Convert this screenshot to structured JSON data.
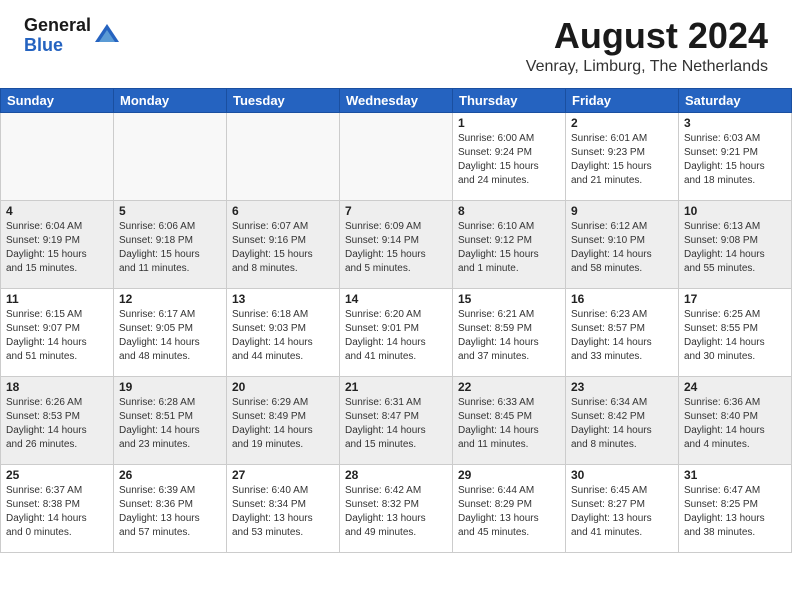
{
  "header": {
    "logo_general": "General",
    "logo_blue": "Blue",
    "month_title": "August 2024",
    "location": "Venray, Limburg, The Netherlands"
  },
  "days_of_week": [
    "Sunday",
    "Monday",
    "Tuesday",
    "Wednesday",
    "Thursday",
    "Friday",
    "Saturday"
  ],
  "weeks": [
    {
      "alt": false,
      "days": [
        {
          "num": "",
          "info": "",
          "empty": true
        },
        {
          "num": "",
          "info": "",
          "empty": true
        },
        {
          "num": "",
          "info": "",
          "empty": true
        },
        {
          "num": "",
          "info": "",
          "empty": true
        },
        {
          "num": "1",
          "info": "Sunrise: 6:00 AM\nSunset: 9:24 PM\nDaylight: 15 hours\nand 24 minutes.",
          "empty": false
        },
        {
          "num": "2",
          "info": "Sunrise: 6:01 AM\nSunset: 9:23 PM\nDaylight: 15 hours\nand 21 minutes.",
          "empty": false
        },
        {
          "num": "3",
          "info": "Sunrise: 6:03 AM\nSunset: 9:21 PM\nDaylight: 15 hours\nand 18 minutes.",
          "empty": false
        }
      ]
    },
    {
      "alt": true,
      "days": [
        {
          "num": "4",
          "info": "Sunrise: 6:04 AM\nSunset: 9:19 PM\nDaylight: 15 hours\nand 15 minutes.",
          "empty": false
        },
        {
          "num": "5",
          "info": "Sunrise: 6:06 AM\nSunset: 9:18 PM\nDaylight: 15 hours\nand 11 minutes.",
          "empty": false
        },
        {
          "num": "6",
          "info": "Sunrise: 6:07 AM\nSunset: 9:16 PM\nDaylight: 15 hours\nand 8 minutes.",
          "empty": false
        },
        {
          "num": "7",
          "info": "Sunrise: 6:09 AM\nSunset: 9:14 PM\nDaylight: 15 hours\nand 5 minutes.",
          "empty": false
        },
        {
          "num": "8",
          "info": "Sunrise: 6:10 AM\nSunset: 9:12 PM\nDaylight: 15 hours\nand 1 minute.",
          "empty": false
        },
        {
          "num": "9",
          "info": "Sunrise: 6:12 AM\nSunset: 9:10 PM\nDaylight: 14 hours\nand 58 minutes.",
          "empty": false
        },
        {
          "num": "10",
          "info": "Sunrise: 6:13 AM\nSunset: 9:08 PM\nDaylight: 14 hours\nand 55 minutes.",
          "empty": false
        }
      ]
    },
    {
      "alt": false,
      "days": [
        {
          "num": "11",
          "info": "Sunrise: 6:15 AM\nSunset: 9:07 PM\nDaylight: 14 hours\nand 51 minutes.",
          "empty": false
        },
        {
          "num": "12",
          "info": "Sunrise: 6:17 AM\nSunset: 9:05 PM\nDaylight: 14 hours\nand 48 minutes.",
          "empty": false
        },
        {
          "num": "13",
          "info": "Sunrise: 6:18 AM\nSunset: 9:03 PM\nDaylight: 14 hours\nand 44 minutes.",
          "empty": false
        },
        {
          "num": "14",
          "info": "Sunrise: 6:20 AM\nSunset: 9:01 PM\nDaylight: 14 hours\nand 41 minutes.",
          "empty": false
        },
        {
          "num": "15",
          "info": "Sunrise: 6:21 AM\nSunset: 8:59 PM\nDaylight: 14 hours\nand 37 minutes.",
          "empty": false
        },
        {
          "num": "16",
          "info": "Sunrise: 6:23 AM\nSunset: 8:57 PM\nDaylight: 14 hours\nand 33 minutes.",
          "empty": false
        },
        {
          "num": "17",
          "info": "Sunrise: 6:25 AM\nSunset: 8:55 PM\nDaylight: 14 hours\nand 30 minutes.",
          "empty": false
        }
      ]
    },
    {
      "alt": true,
      "days": [
        {
          "num": "18",
          "info": "Sunrise: 6:26 AM\nSunset: 8:53 PM\nDaylight: 14 hours\nand 26 minutes.",
          "empty": false
        },
        {
          "num": "19",
          "info": "Sunrise: 6:28 AM\nSunset: 8:51 PM\nDaylight: 14 hours\nand 23 minutes.",
          "empty": false
        },
        {
          "num": "20",
          "info": "Sunrise: 6:29 AM\nSunset: 8:49 PM\nDaylight: 14 hours\nand 19 minutes.",
          "empty": false
        },
        {
          "num": "21",
          "info": "Sunrise: 6:31 AM\nSunset: 8:47 PM\nDaylight: 14 hours\nand 15 minutes.",
          "empty": false
        },
        {
          "num": "22",
          "info": "Sunrise: 6:33 AM\nSunset: 8:45 PM\nDaylight: 14 hours\nand 11 minutes.",
          "empty": false
        },
        {
          "num": "23",
          "info": "Sunrise: 6:34 AM\nSunset: 8:42 PM\nDaylight: 14 hours\nand 8 minutes.",
          "empty": false
        },
        {
          "num": "24",
          "info": "Sunrise: 6:36 AM\nSunset: 8:40 PM\nDaylight: 14 hours\nand 4 minutes.",
          "empty": false
        }
      ]
    },
    {
      "alt": false,
      "days": [
        {
          "num": "25",
          "info": "Sunrise: 6:37 AM\nSunset: 8:38 PM\nDaylight: 14 hours\nand 0 minutes.",
          "empty": false
        },
        {
          "num": "26",
          "info": "Sunrise: 6:39 AM\nSunset: 8:36 PM\nDaylight: 13 hours\nand 57 minutes.",
          "empty": false
        },
        {
          "num": "27",
          "info": "Sunrise: 6:40 AM\nSunset: 8:34 PM\nDaylight: 13 hours\nand 53 minutes.",
          "empty": false
        },
        {
          "num": "28",
          "info": "Sunrise: 6:42 AM\nSunset: 8:32 PM\nDaylight: 13 hours\nand 49 minutes.",
          "empty": false
        },
        {
          "num": "29",
          "info": "Sunrise: 6:44 AM\nSunset: 8:29 PM\nDaylight: 13 hours\nand 45 minutes.",
          "empty": false
        },
        {
          "num": "30",
          "info": "Sunrise: 6:45 AM\nSunset: 8:27 PM\nDaylight: 13 hours\nand 41 minutes.",
          "empty": false
        },
        {
          "num": "31",
          "info": "Sunrise: 6:47 AM\nSunset: 8:25 PM\nDaylight: 13 hours\nand 38 minutes.",
          "empty": false
        }
      ]
    }
  ]
}
